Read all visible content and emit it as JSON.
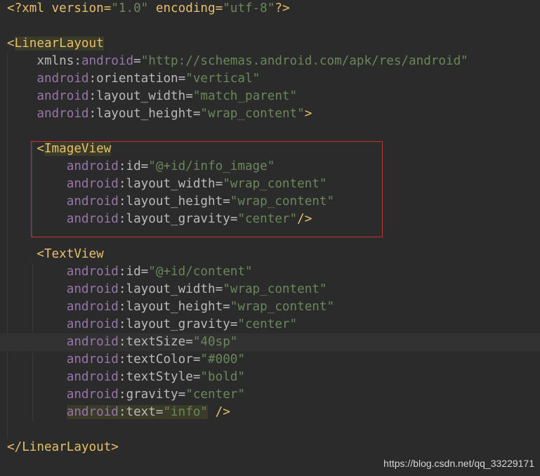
{
  "editor": {
    "lines": [
      {
        "segments": [
          {
            "t": "<?xml version=",
            "c": "pi"
          },
          {
            "t": "\"1.0\"",
            "c": "str"
          },
          {
            "t": " encoding=",
            "c": "pi"
          },
          {
            "t": "\"utf-8\"",
            "c": "str"
          },
          {
            "t": "?>",
            "c": "pi"
          }
        ]
      },
      {
        "segments": []
      },
      {
        "segments": [
          {
            "t": "<",
            "c": "tag"
          },
          {
            "t": "LinearLayout",
            "c": "tagname"
          }
        ]
      },
      {
        "segments": [
          {
            "t": "    xmlns",
            "c": "attr"
          },
          {
            "t": ":",
            "c": "eq"
          },
          {
            "t": "android",
            "c": "ns"
          },
          {
            "t": "=",
            "c": "eq"
          },
          {
            "t": "\"http://schemas.android.com/apk/res/android\"",
            "c": "str"
          }
        ]
      },
      {
        "segments": [
          {
            "t": "    android",
            "c": "ns"
          },
          {
            "t": ":orientation=",
            "c": "attr"
          },
          {
            "t": "\"vertical\"",
            "c": "str"
          }
        ]
      },
      {
        "segments": [
          {
            "t": "    android",
            "c": "ns"
          },
          {
            "t": ":layout_width=",
            "c": "attr"
          },
          {
            "t": "\"match_parent\"",
            "c": "str"
          }
        ]
      },
      {
        "segments": [
          {
            "t": "    android",
            "c": "ns"
          },
          {
            "t": ":layout_height=",
            "c": "attr"
          },
          {
            "t": "\"wrap_content\"",
            "c": "str"
          },
          {
            "t": ">",
            "c": "tag"
          }
        ]
      },
      {
        "segments": []
      },
      {
        "segments": [
          {
            "t": "    <",
            "c": "tag"
          },
          {
            "t": "ImageView",
            "c": "tagname"
          }
        ]
      },
      {
        "segments": [
          {
            "t": "        android",
            "c": "ns"
          },
          {
            "t": ":id=",
            "c": "attr"
          },
          {
            "t": "\"@+id/info_image\"",
            "c": "str"
          }
        ]
      },
      {
        "segments": [
          {
            "t": "        android",
            "c": "ns"
          },
          {
            "t": ":layout_width=",
            "c": "attr"
          },
          {
            "t": "\"wrap_content\"",
            "c": "str"
          }
        ]
      },
      {
        "segments": [
          {
            "t": "        android",
            "c": "ns"
          },
          {
            "t": ":layout_height=",
            "c": "attr"
          },
          {
            "t": "\"wrap_content\"",
            "c": "str"
          }
        ]
      },
      {
        "segments": [
          {
            "t": "        android",
            "c": "ns"
          },
          {
            "t": ":layout_gravity=",
            "c": "attr"
          },
          {
            "t": "\"center\"",
            "c": "str"
          },
          {
            "t": "/>",
            "c": "tag"
          }
        ]
      },
      {
        "segments": []
      },
      {
        "segments": [
          {
            "t": "    <",
            "c": "tag"
          },
          {
            "t": "TextView",
            "c": "tag"
          }
        ]
      },
      {
        "segments": [
          {
            "t": "        android",
            "c": "ns"
          },
          {
            "t": ":id=",
            "c": "attr"
          },
          {
            "t": "\"@+id/content\"",
            "c": "str"
          }
        ]
      },
      {
        "segments": [
          {
            "t": "        android",
            "c": "ns"
          },
          {
            "t": ":layout_width=",
            "c": "attr"
          },
          {
            "t": "\"wrap_content\"",
            "c": "str"
          }
        ]
      },
      {
        "segments": [
          {
            "t": "        android",
            "c": "ns"
          },
          {
            "t": ":layout_height=",
            "c": "attr"
          },
          {
            "t": "\"wrap_content\"",
            "c": "str"
          }
        ]
      },
      {
        "segments": [
          {
            "t": "        android",
            "c": "ns"
          },
          {
            "t": ":layout_gravity=",
            "c": "attr"
          },
          {
            "t": "\"center\"",
            "c": "str"
          }
        ]
      },
      {
        "segments": [
          {
            "t": "        android",
            "c": "ns"
          },
          {
            "t": ":textSize=",
            "c": "attr"
          },
          {
            "t": "\"40sp\"",
            "c": "str"
          }
        ],
        "current": true
      },
      {
        "segments": [
          {
            "t": "        android",
            "c": "ns"
          },
          {
            "t": ":textColor=",
            "c": "attr"
          },
          {
            "t": "\"#000\"",
            "c": "str"
          }
        ]
      },
      {
        "segments": [
          {
            "t": "        android",
            "c": "ns"
          },
          {
            "t": ":textStyle=",
            "c": "attr"
          },
          {
            "t": "\"bold\"",
            "c": "str"
          }
        ]
      },
      {
        "segments": [
          {
            "t": "        android",
            "c": "ns"
          },
          {
            "t": ":gravity=",
            "c": "attr"
          },
          {
            "t": "\"center\"",
            "c": "str"
          }
        ]
      },
      {
        "segments": [
          {
            "t": "        ",
            "c": "attr"
          },
          {
            "t": "android",
            "c": "ns-hl"
          },
          {
            "t": ":text=",
            "c": "attr-hl"
          },
          {
            "t": "\"info\"",
            "c": "str-hl"
          },
          {
            "t": " />",
            "c": "tag"
          }
        ]
      },
      {
        "segments": []
      },
      {
        "segments": [
          {
            "t": "</",
            "c": "tag"
          },
          {
            "t": "LinearLayout",
            "c": "tag"
          },
          {
            "t": ">",
            "c": "tag"
          }
        ]
      }
    ]
  },
  "watermark": "https://blog.csdn.net/qq_33229171",
  "colors": {
    "background": "#2b2b2b",
    "string": "#6a8759",
    "namespace": "#9876aa",
    "tag": "#e8bf6a",
    "attribute": "#bababa",
    "highlight_box": "#c83131"
  }
}
